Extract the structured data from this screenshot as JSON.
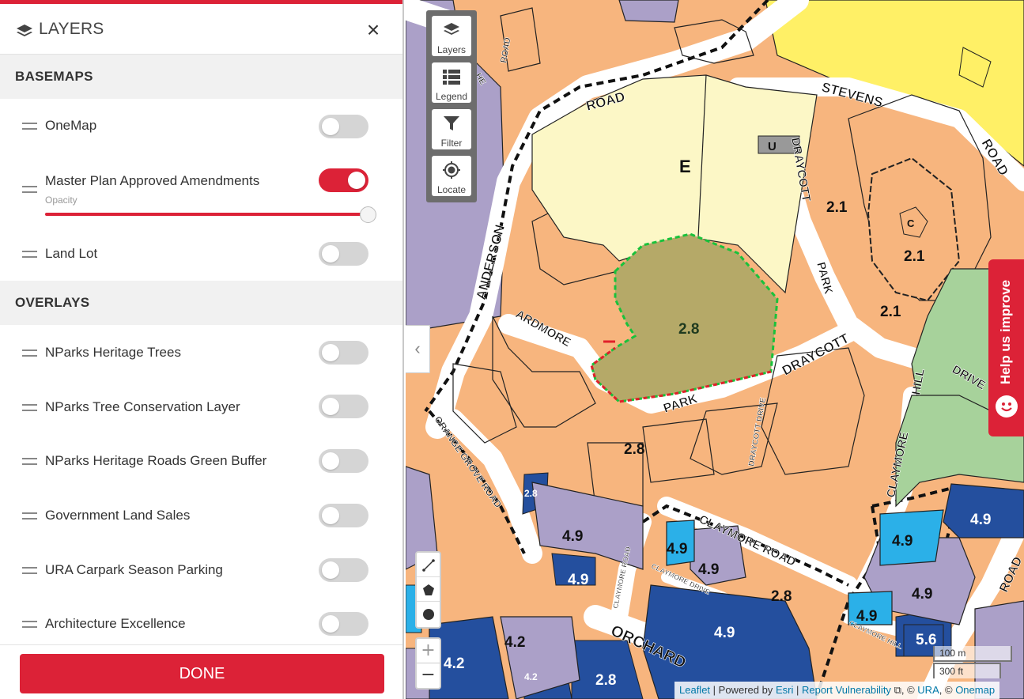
{
  "header": {
    "title": "LAYERS",
    "close": "×"
  },
  "basemaps": {
    "title": "BASEMAPS",
    "items": [
      {
        "label": "OneMap",
        "on": false
      },
      {
        "label": "Master Plan Approved Amendments",
        "on": true
      },
      {
        "label": "Land Lot",
        "on": false
      }
    ],
    "opacity_label": "Opacity",
    "opacity_value": 1.0
  },
  "overlays": {
    "title": "OVERLAYS",
    "items": [
      {
        "label": "NParks Heritage Trees",
        "on": false
      },
      {
        "label": "NParks Tree Conservation Layer",
        "on": false
      },
      {
        "label": "NParks Heritage Roads Green Buffer",
        "on": false
      },
      {
        "label": "Government Land Sales",
        "on": false
      },
      {
        "label": "URA Carpark Season Parking",
        "on": false
      },
      {
        "label": "Architecture Excellence",
        "on": false
      }
    ]
  },
  "footer": {
    "done": "DONE"
  },
  "map": {
    "tools": {
      "layers": "Layers",
      "legend": "Legend",
      "filter": "Filter",
      "locate": "Locate"
    },
    "zoom_in": "+",
    "zoom_out": "−",
    "help": "Help us improve",
    "scale_m": "100 m",
    "scale_ft": "300 ft",
    "attribution": {
      "leaflet": "Leaflet",
      "powered": "| Powered by",
      "esri": "Esri",
      "sep": "|",
      "report": "Report Vulnerability",
      "ura_prefix": ", ©",
      "ura": "URA",
      "onemap_prefix": ", ©",
      "onemap": "Onemap"
    },
    "labels": {
      "road_road": "ROAD",
      "stevens": "STEVENS",
      "road_right": "ROAD",
      "anderson": "ANDERSON",
      "ardmore": "ARDMORE",
      "draycott": "DRAYCOTT",
      "park_right": "PARK",
      "draycott_park": "DRAYCOTT",
      "park_low": "PARK",
      "draycott_drive": "DRAYCOTT DRIVE",
      "orange_grove": "ORANGE GROVE ROAD",
      "claymore_road": "CLAYMORE ROAD",
      "claymore_road_v": "CLAYMORE ROAD",
      "claymore_drive": "CLAYMORE DRIVE",
      "claymore_v": "CLAYMORE",
      "hill": "HILL",
      "drive": "DRIVE",
      "orchard": "ORCHARD",
      "road_orange_top": "ROAD",
      "he": "HE",
      "road_bottom_right": "ROAD",
      "claymore_hill": "CLAYMORE HILL"
    },
    "zones": {
      "e": "E",
      "u": "U",
      "c": "C",
      "z1": "2.8",
      "z2": "2.1",
      "z3": "2.1",
      "z4": "2.1",
      "z5": "2.8",
      "z6": "2.8",
      "z7": "4.9",
      "z8": "4.9",
      "z9": "4.9",
      "z10": "4.9",
      "z11": "4.9",
      "z12": "4.9",
      "z13": "4.9",
      "z14": "4.9",
      "z15": "4.9",
      "z16": "4.2",
      "z17": "4.2",
      "z18": "4.2",
      "z19": "2.8",
      "z20": "5.6",
      "z21": "2.8"
    },
    "colors": {
      "residential": "#f7b57e",
      "park": "#fcf7c6",
      "site": "#b5a968",
      "high_density": "#244f9e",
      "mid": "#aba0c8",
      "light_blue": "#2bb0e8",
      "green": "#a7d29b",
      "yellow": "#fff066",
      "accent": "#dc2237"
    }
  }
}
